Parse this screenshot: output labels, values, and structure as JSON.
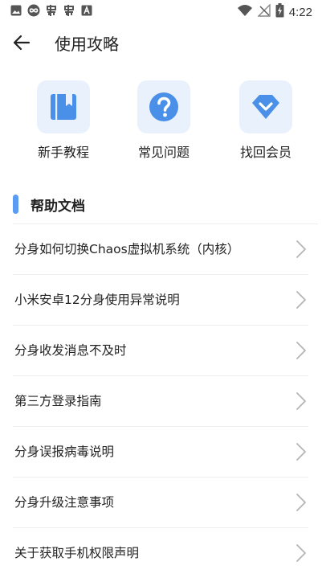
{
  "status_bar": {
    "time": "4:22",
    "left_icons": [
      "image-icon",
      "infinity-icon",
      "bug-icon",
      "bug-icon",
      "a-icon"
    ],
    "right_icons": [
      "wifi-icon",
      "signal-off-icon",
      "battery-charging-icon"
    ]
  },
  "header": {
    "title": "使用攻略"
  },
  "quick_actions": [
    {
      "label": "新手教程",
      "icon": "book-icon"
    },
    {
      "label": "常见问题",
      "icon": "question-icon"
    },
    {
      "label": "找回会员",
      "icon": "diamond-icon"
    }
  ],
  "section": {
    "title": "帮助文档"
  },
  "help_items": [
    {
      "label": "分身如何切换Chaos虚拟机系统（内核）"
    },
    {
      "label": "小米安卓12分身使用异常说明"
    },
    {
      "label": "分身收发消息不及时"
    },
    {
      "label": "第三方登录指南"
    },
    {
      "label": "分身误报病毒说明"
    },
    {
      "label": "分身升级注意事项"
    },
    {
      "label": "关于获取手机权限声明"
    }
  ],
  "colors": {
    "accent": "#5b9bf2",
    "icon_bg": "#e9f1fd",
    "icon_fg": "#4a90e8"
  }
}
